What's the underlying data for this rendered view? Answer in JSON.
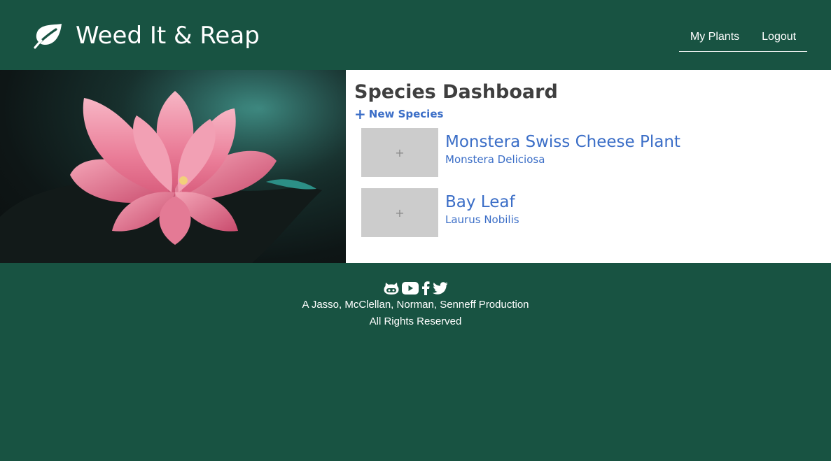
{
  "header": {
    "brand_title": "Weed It & Reap",
    "brand_icon": "leaf-icon",
    "nav": [
      {
        "label": "My Plants"
      },
      {
        "label": "Logout"
      }
    ]
  },
  "hero": {
    "image": "pink-lotus-flower-photo"
  },
  "main": {
    "title": "Species Dashboard",
    "new_species_icon": "plus-icon",
    "new_species_label": "New Species",
    "species": [
      {
        "thumb_label": "+",
        "name": "Monstera Swiss Cheese Plant",
        "scientific": "Monstera Deliciosa"
      },
      {
        "thumb_label": "+",
        "name": "Bay Leaf",
        "scientific": "Laurus Nobilis"
      }
    ]
  },
  "footer": {
    "social_icons": [
      "github-icon",
      "youtube-icon",
      "facebook-icon",
      "twitter-icon"
    ],
    "credit": "A Jasso, McClellan, Norman, Senneff Production",
    "rights": "All Rights Reserved"
  },
  "colors": {
    "brand_green": "#185342",
    "link_blue": "#3b6ec7",
    "thumb_gray": "#cccccc",
    "title_gray": "#3f3f3f"
  }
}
